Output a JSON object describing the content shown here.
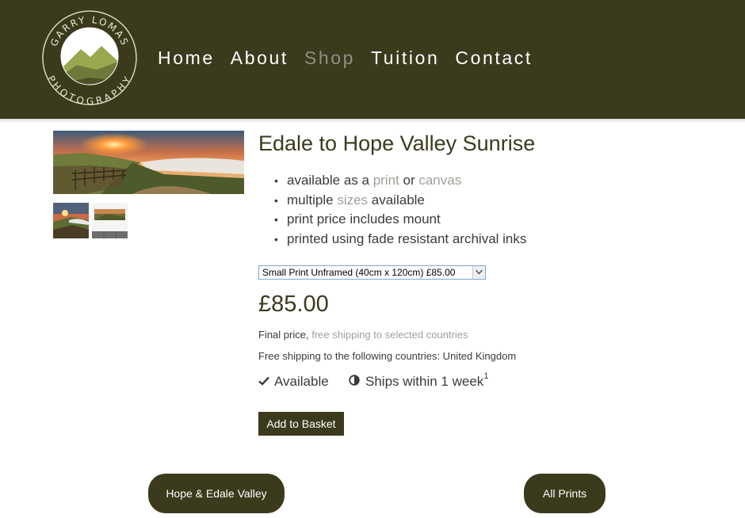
{
  "header": {
    "logo": {
      "top_text": "GARRY LOMAS",
      "bottom_text": "PHOTOGRAPHY",
      "icon": "mountain-logo-icon"
    },
    "nav": [
      {
        "label": "Home",
        "active": false
      },
      {
        "label": "About",
        "active": false
      },
      {
        "label": "Shop",
        "active": true
      },
      {
        "label": "Tuition",
        "active": false
      },
      {
        "label": "Contact",
        "active": false
      }
    ]
  },
  "product": {
    "title": "Edale to Hope Valley Sunrise",
    "bullets": [
      {
        "before": "available as a ",
        "link1": "print",
        "middle": " or ",
        "link2": "canvas",
        "after": ""
      },
      {
        "before": "multiple ",
        "link1": "sizes",
        "after": " available"
      },
      {
        "text": "print price includes mount"
      },
      {
        "text": "printed using fade resistant archival inks"
      }
    ],
    "size_select": {
      "value": "Small Print Unframed (40cm x 120cm) £85.00"
    },
    "price": "£85.00",
    "final_price": {
      "label": "Final price, ",
      "link": "free shipping to selected countries"
    },
    "shipping_countries": "Free shipping to the following countries: United Kingdom",
    "availability": {
      "icon": "check-icon",
      "label": "Available"
    },
    "shipping_time": {
      "icon": "half-circle-icon",
      "label": "Ships within 1 week",
      "footnote": "1"
    },
    "add_button": "Add to Basket"
  },
  "footer_nav": {
    "previous": "Hope & Edale Valley",
    "next": "All Prints"
  },
  "colors": {
    "header_bg": "#3b3a1c",
    "accent": "#3b3a1c",
    "muted": "#a0a09a",
    "nav_active": "#8f8f86"
  }
}
